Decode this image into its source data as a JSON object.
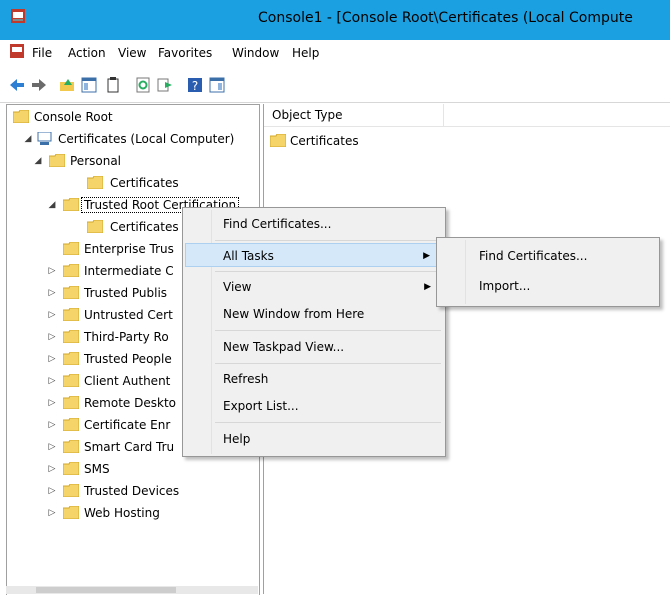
{
  "window": {
    "title": "Console1 - [Console Root\\Certificates (Local Compute",
    "app_icon": "mmc-icon",
    "accent": "#1ba1e2"
  },
  "menu": {
    "items": [
      "File",
      "Action",
      "View",
      "Favorites",
      "Window",
      "Help"
    ]
  },
  "toolbar": {
    "icons": [
      "back-icon",
      "forward-icon",
      "up-folder-icon",
      "show-hide-tree-icon",
      "properties-icon",
      "refresh-icon",
      "export-list-icon",
      "help-icon",
      "show-hide-action-pane-icon"
    ]
  },
  "tree": {
    "items": [
      {
        "label": "Console Root"
      },
      {
        "label": "Certificates (Local Computer)"
      },
      {
        "label": "Personal"
      },
      {
        "label": "Certificates"
      },
      {
        "label": "Trusted Root Certification"
      },
      {
        "label": "Certificates"
      },
      {
        "label": "Enterprise Trus"
      },
      {
        "label": "Intermediate C"
      },
      {
        "label": "Trusted Publis"
      },
      {
        "label": "Untrusted Cert"
      },
      {
        "label": "Third-Party Ro"
      },
      {
        "label": "Trusted People"
      },
      {
        "label": "Client Authent"
      },
      {
        "label": "Remote Deskto"
      },
      {
        "label": "Certificate Enr"
      },
      {
        "label": "Smart Card Tru"
      },
      {
        "label": "SMS"
      },
      {
        "label": "Trusted Devices"
      },
      {
        "label": "Web Hosting"
      }
    ]
  },
  "list": {
    "column_header": "Object Type",
    "rows": [
      {
        "label": "Certificates"
      }
    ]
  },
  "context_menu": {
    "items": [
      {
        "label": "Find Certificates..."
      },
      {
        "label": "All Tasks"
      },
      {
        "label": "View"
      },
      {
        "label": "New Window from Here"
      },
      {
        "label": "New Taskpad View..."
      },
      {
        "label": "Refresh"
      },
      {
        "label": "Export List..."
      },
      {
        "label": "Help"
      }
    ]
  },
  "submenu": {
    "items": [
      {
        "label": "Find Certificates..."
      },
      {
        "label": "Import..."
      }
    ]
  }
}
